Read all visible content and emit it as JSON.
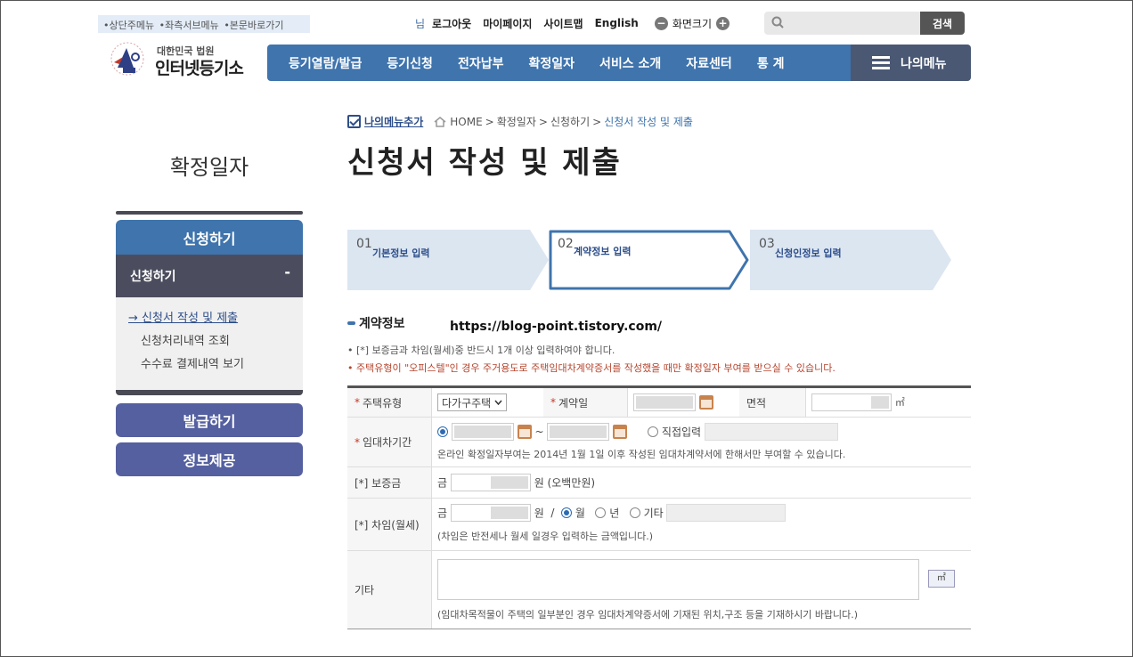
{
  "skip_links": [
    "•상단주메뉴",
    "•좌측서브메뉴",
    "•본문바로가기"
  ],
  "util": {
    "nim": "님",
    "logout": "로그아웃",
    "mypage": "마이페이지",
    "sitemap": "사이트맵",
    "english": "English",
    "zoom_minus": "−",
    "zoom_label": "화면크기",
    "zoom_plus": "+",
    "search_button": "검색"
  },
  "logo": {
    "line1": "대한민국 법원",
    "line2": "인터넷등기소"
  },
  "gnb": [
    "등기열람/발급",
    "등기신청",
    "전자납부",
    "확정일자",
    "서비스 소개",
    "자료센터",
    "통 계"
  ],
  "my_menu": "나의메뉴",
  "sidebar": {
    "title": "확정일자",
    "main": "신청하기",
    "sub": "신청하기",
    "sub_toggle": "-",
    "items": [
      "신청서 작성 및 제출",
      "신청처리내역 조회",
      "수수료 결제내역 보기"
    ],
    "active_marker": "→ ",
    "btn1": "발급하기",
    "btn2": "정보제공"
  },
  "breadcrumb": {
    "add": "나의메뉴추가",
    "items": [
      "HOME",
      "확정일자",
      "신청하기",
      "신청서 작성 및 제출"
    ],
    "sep": ">"
  },
  "page_title": "신청서 작성 및 제출",
  "steps": [
    {
      "num": "01",
      "label": "기본정보 입력",
      "state": "done"
    },
    {
      "num": "02",
      "label": "계약정보 입력",
      "state": "current"
    },
    {
      "num": "03",
      "label": "신청인정보 입력",
      "state": "todo"
    }
  ],
  "section_title": "계약정보",
  "watermark_url": "https://blog-point.tistory.com/",
  "notes": [
    "• [*] 보증금과 차임(월세)중 반드시 1개 이상 입력하여야 합니다.",
    "• 주택유형이 \"오피스텔\"인 경우 주거용도로 주택임대차계약증서를 작성했을 때만 확정일자 부여를 받으실 수 있습니다."
  ],
  "form": {
    "house_type": {
      "label": "주택유형",
      "value": "다가구주택"
    },
    "contract_date": {
      "label": "계약일"
    },
    "area": {
      "label": "면적",
      "unit": "㎡"
    },
    "lease_period": {
      "label": "임대차기간",
      "tilde": "~",
      "direct": "직접입력",
      "note": "온라인 확정일자부여는 2014년 1월 1일 이후 작성된 임대차계약서에 한해서만 부여할 수 있습니다."
    },
    "deposit": {
      "label": "[*] 보증금",
      "prefix": "금",
      "suffix": "원 (오백만원)"
    },
    "rent": {
      "label": "[*] 차임(월세)",
      "prefix": "금",
      "suffix": "원",
      "slash": "/",
      "opt_month": "월",
      "opt_year": "년",
      "opt_etc": "기타",
      "note": "(차임은 반전세나 월세 일경우 입력하는 금액입니다.)"
    },
    "etc": {
      "label": "기타",
      "m2_button": "㎡",
      "note": "(임대차목적물이 주택의 일부분인 경우 임대차계약증서에 기재된 위치,구조 등을 기재하시기 바랍니다.)"
    },
    "required_mark": "*"
  },
  "colors": {
    "primary": "#3f74ad",
    "dark": "#4b4d5e",
    "accent_red": "#b5442d",
    "side_btn": "#5560a0"
  }
}
